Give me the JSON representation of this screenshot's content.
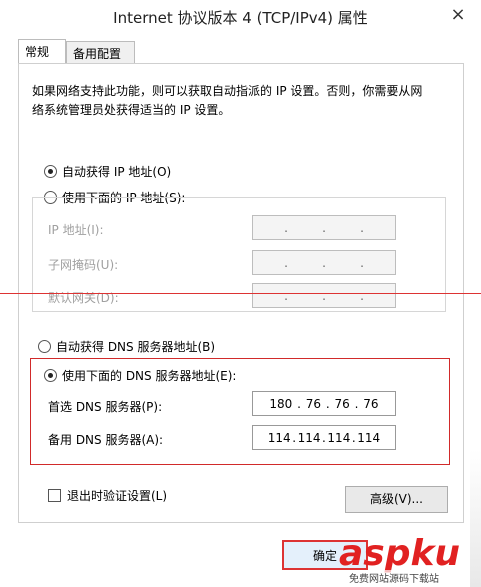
{
  "window": {
    "title": "Internet 协议版本 4 (TCP/IPv4) 属性",
    "close_glyph": "×"
  },
  "tabs": [
    {
      "label": "常规",
      "active": true
    },
    {
      "label": "备用配置",
      "active": false
    }
  ],
  "description": "如果网络支持此功能，则可以获取自动指派的 IP 设置。否则，你需要从网络系统管理员处获得适当的 IP 设置。",
  "ip_section": {
    "auto_label": "自动获得 IP 地址(O)",
    "manual_label": "使用下面的 IP 地址(S):",
    "selected": "auto",
    "fields": [
      {
        "label": "IP 地址(I):",
        "value": [
          ".",
          ".",
          "."
        ]
      },
      {
        "label": "子网掩码(U):",
        "value": [
          ".",
          ".",
          "."
        ]
      },
      {
        "label": "默认网关(D):",
        "value": [
          ".",
          ".",
          "."
        ]
      }
    ]
  },
  "dns_section": {
    "auto_label": "自动获得 DNS 服务器地址(B)",
    "manual_label": "使用下面的 DNS 服务器地址(E):",
    "selected": "manual",
    "preferred": {
      "label": "首选 DNS 服务器(P):",
      "octets": [
        "180",
        "76",
        "76",
        "76"
      ]
    },
    "alternate": {
      "label": "备用 DNS 服务器(A):",
      "octets": [
        "114",
        "114",
        "114",
        "114"
      ]
    }
  },
  "validate_label": "退出时验证设置(L)",
  "advanced_label": "高级(V)...",
  "ok_label": "确定",
  "watermark": {
    "logo": "aspku",
    "sub": "免费网站源码下载站"
  },
  "colors": {
    "highlight": "#d12a2a",
    "watermark": "#e12121"
  }
}
